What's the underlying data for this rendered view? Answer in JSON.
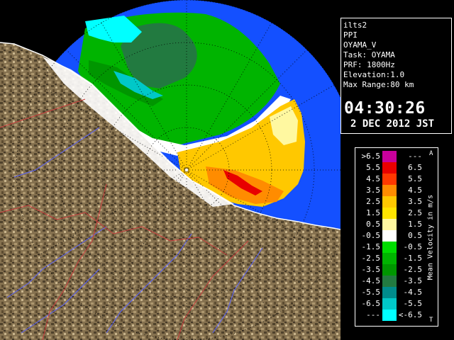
{
  "info": {
    "lines": [
      "ilts2",
      "PPI",
      "OYAMA_V",
      "Task: OYAMA",
      "PRF: 1800Hz",
      "Elevation:1.0",
      "Max Range:80 km"
    ],
    "time": "04:30:26",
    "date": "2 DEC 2012 JST"
  },
  "legend": {
    "unit": "Mean Velocity in m/s",
    "flag_top": "A",
    "flag_bottom": "T",
    "rows": [
      {
        "left": ">6.5",
        "right": "---",
        "color": "#c8009c"
      },
      {
        "left": "5.5",
        "right": "6.5",
        "color": "#e80000"
      },
      {
        "left": "4.5",
        "right": "5.5",
        "color": "#ff3800"
      },
      {
        "left": "3.5",
        "right": "4.5",
        "color": "#ff8c00"
      },
      {
        "left": "2.5",
        "right": "3.5",
        "color": "#ffc800"
      },
      {
        "left": "1.5",
        "right": "2.5",
        "color": "#ffe400"
      },
      {
        "left": "0.5",
        "right": "1.5",
        "color": "#fff8a0"
      },
      {
        "left": "-0.5",
        "right": "0.5",
        "color": "#ffffff"
      },
      {
        "left": "-1.5",
        "right": "-0.5",
        "color": "#00dc00"
      },
      {
        "left": "-2.5",
        "right": "-1.5",
        "color": "#00b400"
      },
      {
        "left": "-3.5",
        "right": "-2.5",
        "color": "#009600"
      },
      {
        "left": "-4.5",
        "right": "-3.5",
        "color": "#227a40"
      },
      {
        "left": "-5.5",
        "right": "-4.5",
        "color": "#008c8c"
      },
      {
        "left": "-6.5",
        "right": "-5.5",
        "color": "#00c8c8"
      },
      {
        "left": "---",
        "right": "<-6.5",
        "color": "#00ffff"
      }
    ]
  },
  "colors": {
    "radar_range": "#1450ff",
    "terrain": "#6e5a3c",
    "rivers": "#5a64ff",
    "boundaries": "#c83c3c",
    "grid": "#000000"
  }
}
